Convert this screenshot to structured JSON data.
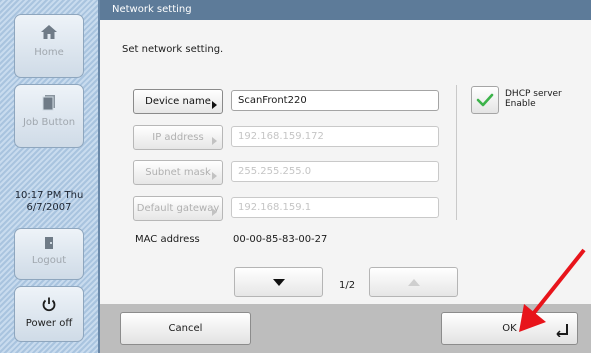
{
  "window": {
    "title": "Network setting"
  },
  "sidebar": {
    "home_label": "Home",
    "job_button_label": "Job Button",
    "clock_line1": "10:17 PM  Thu",
    "clock_line2": "6/7/2007",
    "logout_label": "Logout",
    "power_label": "Power off",
    "icons": {
      "home": "home-icon",
      "job": "job-button-icon",
      "logout": "logout-icon",
      "power": "power-icon"
    }
  },
  "form": {
    "instruction": "Set network setting.",
    "device_name": {
      "label": "Device name",
      "value": "ScanFront220",
      "enabled": true
    },
    "ip_address": {
      "label": "IP address",
      "value": "192.168.159.172",
      "enabled": false
    },
    "subnet_mask": {
      "label": "Subnet mask",
      "value": "255.255.255.0",
      "enabled": false
    },
    "default_gateway": {
      "label": "Default gateway",
      "value": "192.168.159.1",
      "enabled": false
    },
    "dhcp": {
      "label_line1": "DHCP server",
      "label_line2": "Enable",
      "checked": true
    },
    "mac": {
      "label": "MAC address",
      "value": "00-00-85-83-00-27"
    }
  },
  "pager": {
    "indicator": "1/2",
    "down_icon": "arrow-down-icon",
    "up_icon": "arrow-up-icon"
  },
  "footer": {
    "cancel_label": "Cancel",
    "ok_label": "OK",
    "ok_icon": "enter-icon"
  },
  "colors": {
    "titlebar": "#5d7b99",
    "checkmark": "#3cb34a",
    "annotation_arrow": "#e8141b"
  }
}
